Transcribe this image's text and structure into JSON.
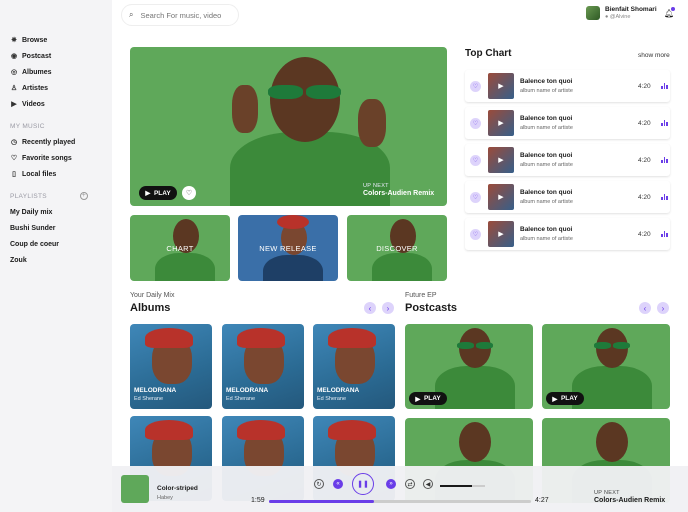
{
  "sidebar": {
    "nav": [
      {
        "label": "Browse",
        "icon": "compass-icon"
      },
      {
        "label": "Postcast",
        "icon": "podcast-icon"
      },
      {
        "label": "Albumes",
        "icon": "album-icon"
      },
      {
        "label": "Artistes",
        "icon": "user-icon"
      },
      {
        "label": "Videos",
        "icon": "video-icon"
      }
    ],
    "my_music_title": "MY MUSIC",
    "my_music": [
      {
        "label": "Recently played",
        "icon": "clock-icon"
      },
      {
        "label": "Favorite songs",
        "icon": "heart-icon"
      },
      {
        "label": "Local files",
        "icon": "file-icon"
      }
    ],
    "playlists_title": "PLAYLISTS",
    "playlists": [
      "My Daily mix",
      "Bushi Sunder",
      "Coup de coeur",
      "Zouk"
    ]
  },
  "search": {
    "placeholder": "Search For music, video"
  },
  "user": {
    "name": "Bienfait Shomari",
    "handle": "@Alvine"
  },
  "hero": {
    "play_label": "PLAY",
    "up_next_label": "UP NEXT",
    "up_next_title": "Colors-Audien Remix"
  },
  "tiles": [
    "CHART",
    "NEW RELEASE",
    "DISCOVER"
  ],
  "top_chart": {
    "title": "Top Chart",
    "show_more": "show more",
    "items": [
      {
        "title": "Balence ton quoi",
        "subtitle": "album name of artiste",
        "duration": "4:20"
      },
      {
        "title": "Balence ton quoi",
        "subtitle": "album name of artiste",
        "duration": "4:20"
      },
      {
        "title": "Balence ton quoi",
        "subtitle": "album name of artiste",
        "duration": "4:20"
      },
      {
        "title": "Balence ton quoi",
        "subtitle": "album name of artiste",
        "duration": "4:20"
      },
      {
        "title": "Balence ton quoi",
        "subtitle": "album name of artiste",
        "duration": "4:20"
      }
    ]
  },
  "albums": {
    "subtitle": "Your Daily Mix",
    "title": "Albums",
    "items": [
      {
        "title": "MELODRANA",
        "artist": "Ed Sherane"
      },
      {
        "title": "MELODRANA",
        "artist": "Ed Sherane"
      },
      {
        "title": "MELODRANA",
        "artist": "Ed Sherane"
      }
    ]
  },
  "podcasts": {
    "subtitle": "Future EP",
    "title": "Postcasts",
    "play_label": "PLAY"
  },
  "player": {
    "song": "Color-striped",
    "artist": "Habey",
    "elapsed": "1:59",
    "total": "4:27",
    "progress": 0.4,
    "volume": 0.7,
    "up_next_label": "UP NEXT",
    "up_next_title": "Colors-Audien Remix"
  },
  "colors": {
    "accent": "#6a3de8",
    "accent_light": "#ddd3fb",
    "hero_green": "#5fa85a"
  }
}
